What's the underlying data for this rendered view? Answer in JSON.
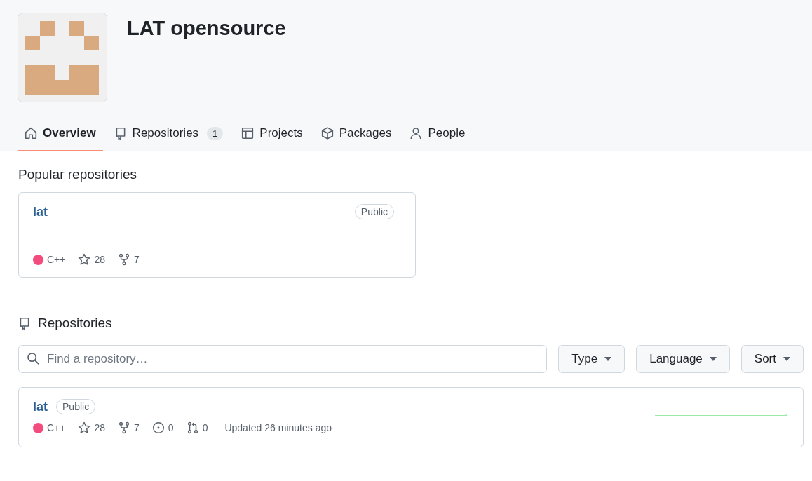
{
  "org": {
    "name": "LAT opensource"
  },
  "tabs": [
    {
      "label": "Overview",
      "selected": true
    },
    {
      "label": "Repositories",
      "counter": "1",
      "selected": false
    },
    {
      "label": "Projects",
      "selected": false
    },
    {
      "label": "Packages",
      "selected": false
    },
    {
      "label": "People",
      "selected": false
    }
  ],
  "popular": {
    "heading": "Popular repositories",
    "repos": [
      {
        "name": "lat",
        "visibility": "Public",
        "language": "C++",
        "color": "#f34b7d",
        "stars": "28",
        "forks": "7"
      }
    ]
  },
  "repositories": {
    "heading": "Repositories",
    "search": {
      "placeholder": "Find a repository…"
    },
    "filters": [
      "Type",
      "Language",
      "Sort"
    ],
    "items": [
      {
        "name": "lat",
        "visibility": "Public",
        "language": "C++",
        "color": "#f34b7d",
        "stars": "28",
        "forks": "7",
        "issues": "0",
        "pulls": "0",
        "updated": "Updated 26 minutes ago"
      }
    ]
  }
}
